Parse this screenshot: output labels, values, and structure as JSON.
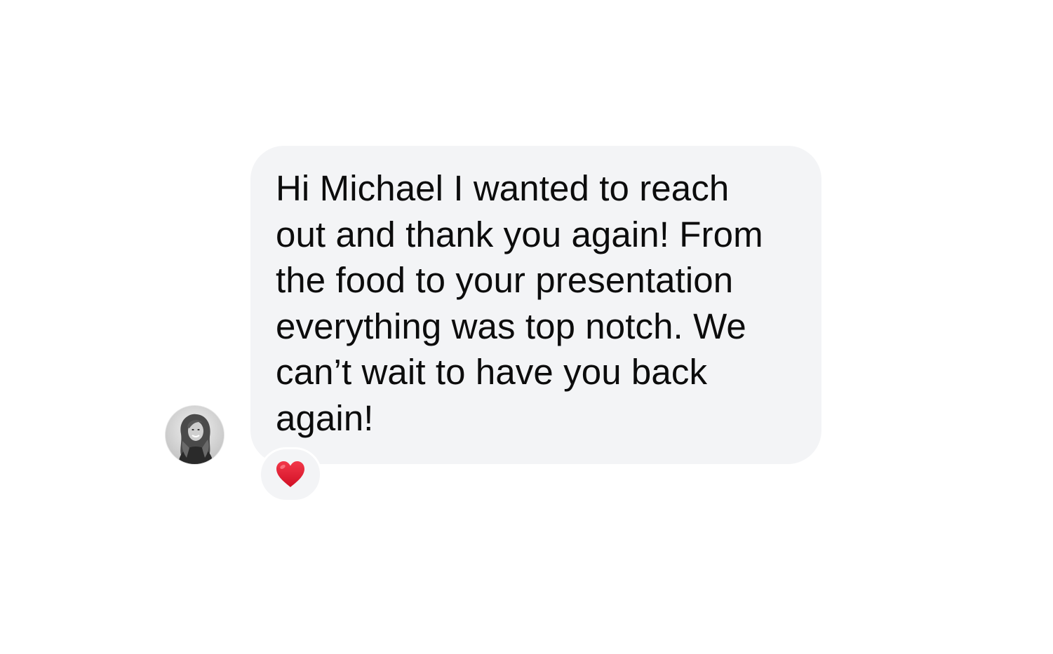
{
  "conversation": {
    "avatar": {
      "icon": "person-photo-avatar"
    },
    "message": {
      "text": "Hi Michael I wanted to reach\nout and thank you again! From\nthe food to your presentation\neverything was top notch. We\ncan’t wait to have you back\nagain!",
      "bubble_color": "#f3f4f6",
      "text_color": "#0c0c0c"
    },
    "reaction": {
      "icon": "red-heart-icon",
      "color": "#e0172b"
    }
  }
}
